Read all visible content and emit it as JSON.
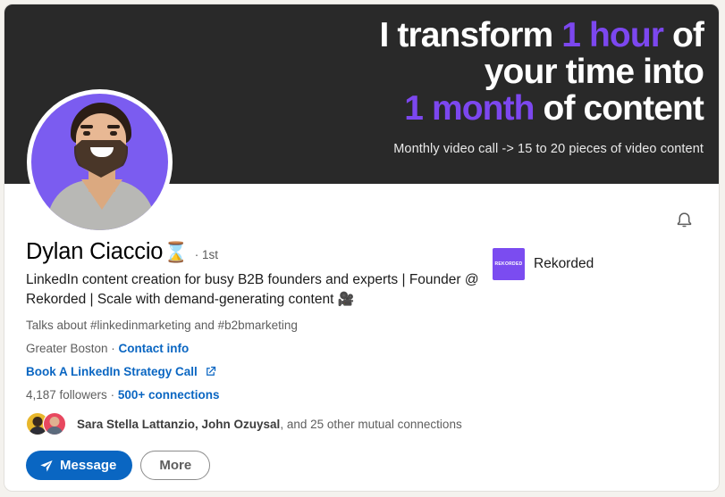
{
  "banner": {
    "line1_pre": "I transform ",
    "line1_accent": "1 hour",
    "line1_post": " of",
    "line2": "your time into",
    "line3_accent": "1 month",
    "line3_post": " of content",
    "subtitle": "Monthly video call -> 15 to 20 pieces of video content",
    "bg_color": "#292929",
    "accent_color": "#7c47ef"
  },
  "profile": {
    "name": "Dylan Ciaccio",
    "name_emoji": "⌛",
    "degree": "· 1st",
    "headline": "LinkedIn content creation for busy B2B founders and experts | Founder @ Rekorded | Scale with demand-generating content ",
    "headline_emoji": "🎥",
    "talks_about": "Talks about #linkedinmarketing and #b2bmarketing",
    "location": "Greater Boston",
    "location_separator": " · ",
    "contact_info_link": "Contact info",
    "website_link": "Book A LinkedIn Strategy Call",
    "followers": "4,187 followers",
    "followers_separator": "  · ",
    "connections": "500+ connections",
    "mutual_names": "Sara Stella Lattanzio, John Ozuysal",
    "mutual_rest": ", and 25 other mutual connections"
  },
  "company": {
    "name": "Rekorded",
    "logo_text": "REKORDED",
    "logo_color": "#7b4cf0"
  },
  "actions": {
    "message_label": "Message",
    "more_label": "More",
    "primary_color": "#0a66c2"
  },
  "icons": {
    "bell": "notification-bell",
    "send": "send-plane",
    "external": "external-link"
  }
}
